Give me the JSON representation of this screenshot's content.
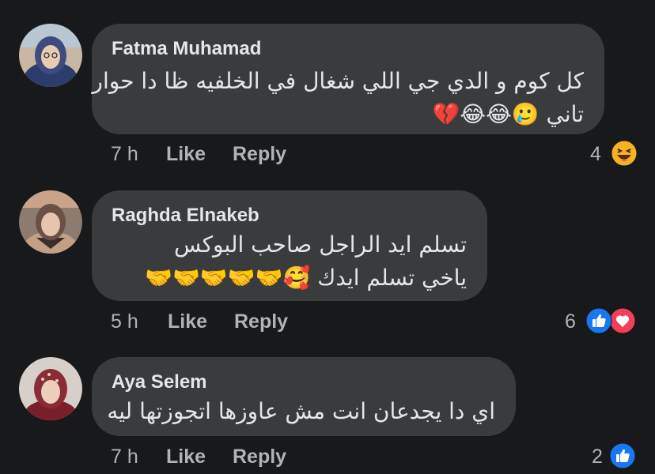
{
  "comments": [
    {
      "author": "Fatma Muhamad",
      "line1": "كل كوم و الدي جي اللي شغال في الخلفيه ظا دا حوار",
      "line2": "تاني 🥲😂😂💔",
      "time": "7 h",
      "like": "Like",
      "reply": "Reply",
      "reaction_count": "4",
      "reactions": [
        "haha-icon"
      ]
    },
    {
      "author": "Raghda Elnakeb",
      "line1": "تسلم ايد الراجل صاحب البوكس",
      "line2": "ياخي تسلم ايدك 🥰🤝🤝🤝🤝🤝",
      "time": "5 h",
      "like": "Like",
      "reply": "Reply",
      "reaction_count": "6",
      "reactions": [
        "like-icon",
        "love-icon"
      ]
    },
    {
      "author": "Aya Selem",
      "line1": "اي دا يجدعان انت مش عاوزها اتجوزتها ليه",
      "time": "7 h",
      "like": "Like",
      "reply": "Reply",
      "reaction_count": "2",
      "reactions": [
        "like-icon"
      ]
    }
  ],
  "colors": {
    "background": "#18191a",
    "bubble": "#3a3b3c",
    "secondary_text": "#b0b3b8",
    "like_blue": "#1877f2",
    "love_red": "#f33e58",
    "haha_yellow": "#f7b125"
  }
}
